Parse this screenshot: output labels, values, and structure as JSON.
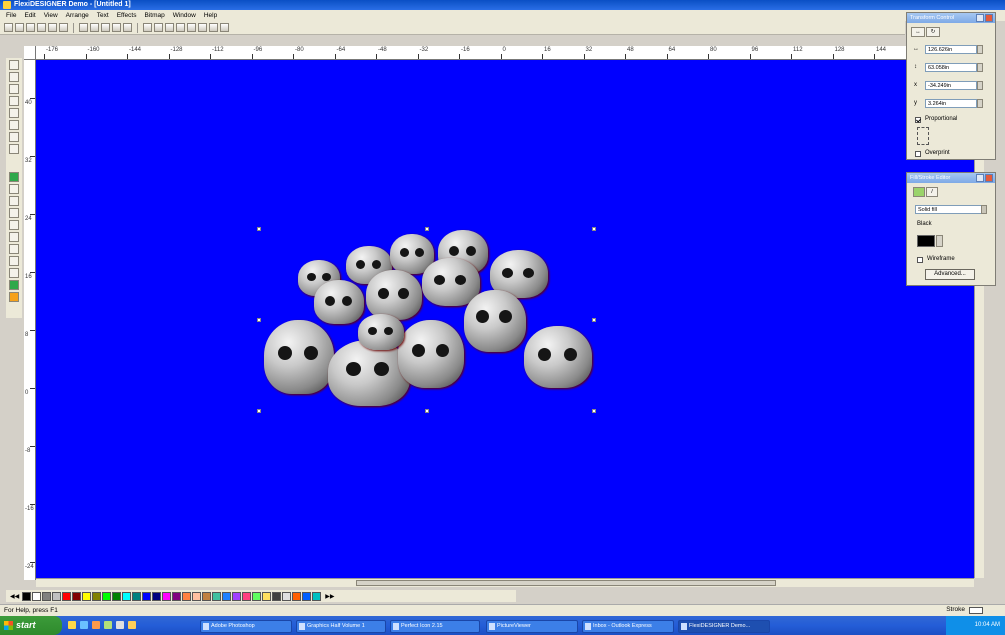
{
  "window": {
    "title": "FlexiDESIGNER Demo - [Untitled 1]"
  },
  "menu": [
    "File",
    "Edit",
    "View",
    "Arrange",
    "Text",
    "Effects",
    "Bitmap",
    "Window",
    "Help"
  ],
  "ruler": {
    "top": [
      "-176",
      "-160",
      "-144",
      "-128",
      "-112",
      "-96",
      "-80",
      "-64",
      "-48",
      "-32",
      "-16",
      "0",
      "16",
      "32",
      "48",
      "64",
      "80",
      "96",
      "112",
      "128",
      "144"
    ],
    "left": [
      "40",
      "32",
      "24",
      "16",
      "8",
      "0",
      "-8",
      "-16",
      "-24"
    ]
  },
  "transform_panel": {
    "title": "Transform Control",
    "width": "126.626in",
    "height": "63.058in",
    "x": "-34.249in",
    "y": "3.264in",
    "proportional_label": "Proportional",
    "proportional_checked": true,
    "overprint_label": "Overprint"
  },
  "fill_panel": {
    "title": "Fill/Stroke Editor",
    "fill_type": "Solid fill",
    "color_name": "Black",
    "wireframe_label": "Wireframe",
    "advanced_label": "Advanced..."
  },
  "status": {
    "help": "For Help, press F1",
    "stroke_label": "Stroke"
  },
  "palette": {
    "colors": [
      "#000000",
      "#ffffff",
      "#808080",
      "#c0c0c0",
      "#ff0000",
      "#800000",
      "#ffff00",
      "#808000",
      "#00ff00",
      "#008000",
      "#00ffff",
      "#008080",
      "#0000ff",
      "#000080",
      "#ff00ff",
      "#800080",
      "#ff8040",
      "#ffc0a0",
      "#c08040",
      "#40c0a0",
      "#2080ff",
      "#a040ff",
      "#ff4080",
      "#60ff60",
      "#ffe060",
      "#404040",
      "#e0e0e0",
      "#ff6000",
      "#0060ff",
      "#00c0c0"
    ]
  },
  "taskbar": {
    "start_label": "start",
    "tasks": [
      {
        "label": "Adobe Photoshop",
        "active": false
      },
      {
        "label": "Graphics Half Volume 1",
        "active": false
      },
      {
        "label": "Perfect Icon 2.15",
        "active": false
      },
      {
        "label": "PictureViewer",
        "active": false
      },
      {
        "label": "Inbox - Outlook Express",
        "active": false
      },
      {
        "label": "FlexiDESIGNER Demo...",
        "active": true
      }
    ],
    "clock": "10:04 AM"
  }
}
